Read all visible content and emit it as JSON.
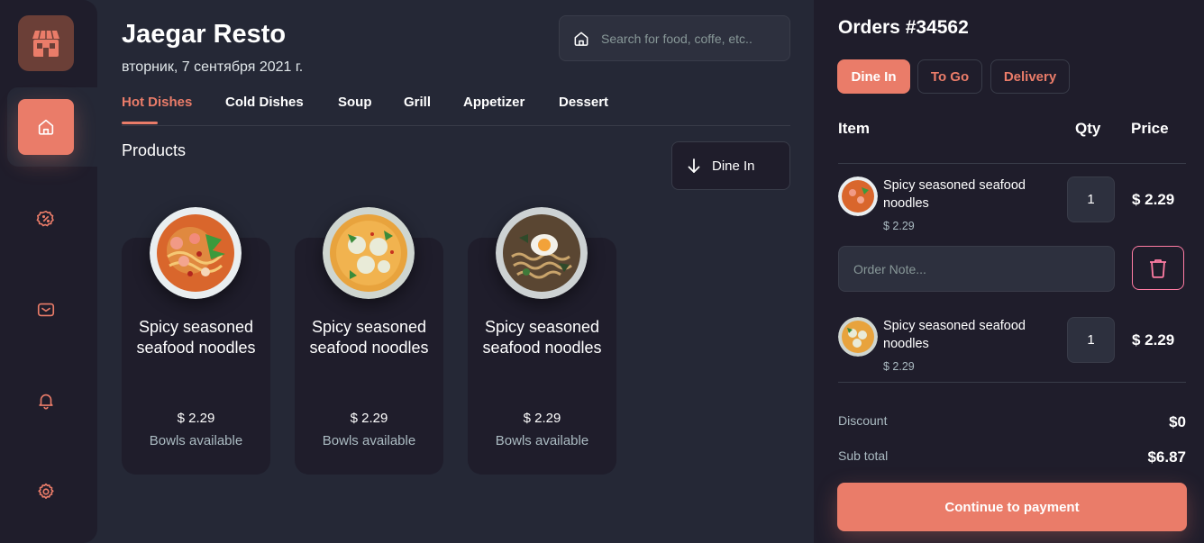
{
  "brand": {
    "accent": "#EA7C69",
    "logo_icon": "restaurant-storefront-icon"
  },
  "sidebar": {
    "items": [
      {
        "icon": "home-icon",
        "active": true
      },
      {
        "icon": "discount-icon",
        "active": false
      },
      {
        "icon": "message-icon",
        "active": false
      },
      {
        "icon": "notification-bell-icon",
        "active": false
      },
      {
        "icon": "settings-gear-icon",
        "active": false
      }
    ]
  },
  "header": {
    "title": "Jaegar Resto",
    "date": "вторник, 7 сентября 2021 г."
  },
  "search": {
    "placeholder": "Search for food, coffe, etc.."
  },
  "tabs": [
    "Hot Dishes",
    "Cold Dishes",
    "Soup",
    "Grill",
    "Appetizer",
    "Dessert"
  ],
  "products": {
    "title": "Products",
    "order_type_select": "Dine In",
    "items": [
      {
        "name": "Spicy seasoned seafood noodles",
        "price": "$ 2.29",
        "availability": "Bowls available"
      },
      {
        "name": "Spicy seasoned seafood noodles",
        "price": "$ 2.29",
        "availability": "Bowls available"
      },
      {
        "name": "Spicy seasoned seafood noodles",
        "price": "$ 2.29",
        "availability": "Bowls available"
      }
    ]
  },
  "order": {
    "title": "Orders #34562",
    "types": [
      "Dine In",
      "To Go",
      "Delivery"
    ],
    "active_type": "Dine In",
    "columns": {
      "item": "Item",
      "qty": "Qty",
      "price": "Price"
    },
    "note_placeholder": "Order Note...",
    "items": [
      {
        "name": "Spicy seasoned seafood noodles",
        "unit_price": "$ 2.29",
        "qty": "1",
        "total": "$ 2.29"
      },
      {
        "name": "Spicy seasoned seafood noodles",
        "unit_price": "$ 2.29",
        "qty": "1",
        "total": "$ 2.29"
      }
    ],
    "summary": {
      "discount_label": "Discount",
      "discount_value": "$0",
      "subtotal_label": "Sub total",
      "subtotal_value": "$6.87"
    },
    "continue_label": "Continue to payment"
  }
}
